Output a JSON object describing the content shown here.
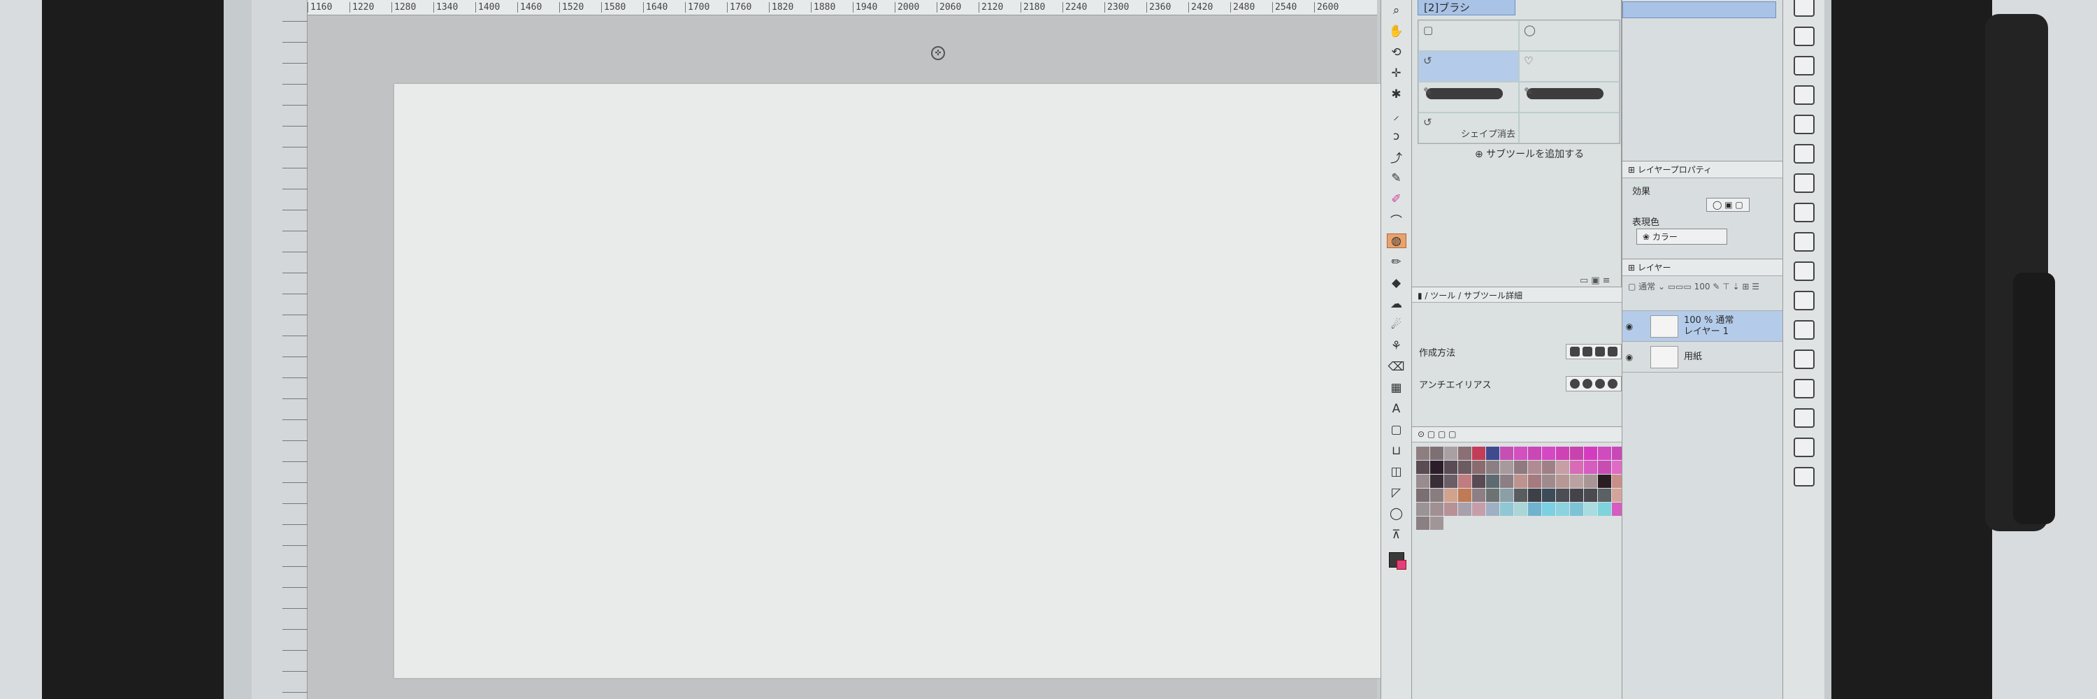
{
  "ruler": {
    "top_ticks": [
      "1160",
      "1220",
      "1280",
      "1340",
      "1400",
      "1460",
      "1520",
      "1580",
      "1640",
      "1700",
      "1760",
      "1820",
      "1880",
      "1940",
      "2000",
      "2060",
      "2120",
      "2180",
      "2240",
      "2300",
      "2360",
      "2420",
      "2480",
      "2540",
      "2600"
    ]
  },
  "toolbar": {
    "tools": [
      {
        "icon": "zoom-icon",
        "glyph": "⌕"
      },
      {
        "icon": "hand-icon",
        "glyph": "✋"
      },
      {
        "icon": "rotate-icon",
        "glyph": "⟲"
      },
      {
        "icon": "move-icon",
        "glyph": "✛"
      },
      {
        "icon": "sparkle-icon",
        "glyph": "✱"
      },
      {
        "icon": "select-icon",
        "glyph": "⸝"
      },
      {
        "icon": "lasso-icon",
        "glyph": "ↄ"
      },
      {
        "icon": "eyedropper-icon",
        "glyph": "⤴"
      },
      {
        "icon": "pen-icon",
        "glyph": "✎"
      },
      {
        "icon": "pencil-icon",
        "glyph": "✐",
        "pink": true
      },
      {
        "icon": "brush-icon",
        "glyph": "⌒"
      },
      {
        "icon": "airbrush-icon",
        "glyph": "◍",
        "active": true
      },
      {
        "icon": "marker-icon",
        "glyph": "✏"
      },
      {
        "icon": "fill-icon",
        "glyph": "◆"
      },
      {
        "icon": "blend-icon",
        "glyph": "☁"
      },
      {
        "icon": "liquify-icon",
        "glyph": "☄"
      },
      {
        "icon": "stamp-icon",
        "glyph": "⚘"
      },
      {
        "icon": "eraser-icon",
        "glyph": "⌫"
      },
      {
        "icon": "layer-fill-icon",
        "glyph": "▦"
      },
      {
        "icon": "text-icon",
        "glyph": "A"
      },
      {
        "icon": "frame-icon",
        "glyph": "▢"
      },
      {
        "icon": "balloon-icon",
        "glyph": "⊔"
      },
      {
        "icon": "figure-icon",
        "glyph": "◫"
      },
      {
        "icon": "ruler-icon",
        "glyph": "◸"
      },
      {
        "icon": "correction-icon",
        "glyph": "◯"
      },
      {
        "icon": "gradient-icon",
        "glyph": "⊼"
      }
    ]
  },
  "subtool": {
    "header": "[2]ブラシ",
    "items": [
      {
        "label": "",
        "icon": "▢"
      },
      {
        "label": "",
        "icon": "◯"
      },
      {
        "label": "",
        "icon": "↺",
        "selected": true
      },
      {
        "label": "",
        "icon": "♡"
      },
      {
        "label": "",
        "icon": "✎",
        "stroke": true
      },
      {
        "label": "",
        "icon": "✎",
        "stroke": true
      },
      {
        "label": "シェイプ消去",
        "icon": "↺"
      },
      {
        "label": "",
        "icon": ""
      }
    ],
    "add_label": "⊕ サブツールを追加する"
  },
  "tool_property": {
    "title": "",
    "rows": [
      {
        "label": "作成方法"
      },
      {
        "label": "アンチエイリアス"
      }
    ]
  },
  "palette": {
    "colors": [
      "#8f7e80",
      "#7e6f72",
      "#a9a0a3",
      "#8a6f74",
      "#c23e58",
      "#404b8f",
      "#c64fb3",
      "#d44fbf",
      "#c947b6",
      "#d548c4",
      "#cf42b6",
      "#c843ad",
      "#d43cc0",
      "#d04bbd",
      "#c948b8",
      "#5a4c52",
      "#2b1e2a",
      "#5b4b55",
      "#6d5b62",
      "#8a6b6f",
      "#8c7f84",
      "#a7999c",
      "#8f7a80",
      "#b08b93",
      "#a08087",
      "#c79ea4",
      "#d86ab6",
      "#d65cc0",
      "#c84db3",
      "#df6bc6",
      "#9a8b8f",
      "#3a2e36",
      "#6b5e66",
      "#c07c7f",
      "#594a53",
      "#5d6b70",
      "#8d7e83",
      "#bd938f",
      "#a57b80",
      "#a08a8d",
      "#b79895",
      "#bca1a2",
      "#a99596",
      "#2a1d24",
      "#c88e8a",
      "#7b6f73",
      "#8a7d80",
      "#d1a28e",
      "#c07a55",
      "#8e7f84",
      "#6d7272",
      "#8aa0a6",
      "#5a5d60",
      "#3e4047",
      "#3e4b58",
      "#4c4d55",
      "#45434a",
      "#4a4a50",
      "#5a6063",
      "#d4a49a",
      "#9a9496",
      "#a18f93",
      "#b69296",
      "#a9a0ae",
      "#c69ea9",
      "#9fb0c4",
      "#8fc7d5",
      "#aad6d7",
      "#6fb3cf",
      "#7bd0e3",
      "#8cd3df",
      "#7cc3d5",
      "#a8dce0",
      "#7ed3dc",
      "#d45dbf",
      "#8a7f82",
      "#a29598"
    ]
  },
  "layer_property": {
    "effect_label": "効果",
    "color_label": "表現色",
    "color_value": "カラー"
  },
  "layers": {
    "items": [
      {
        "name1": "100 % 通常",
        "name2": "レイヤー 1",
        "selected": true
      },
      {
        "name1": "",
        "name2": "用紙",
        "selected": false
      }
    ]
  }
}
